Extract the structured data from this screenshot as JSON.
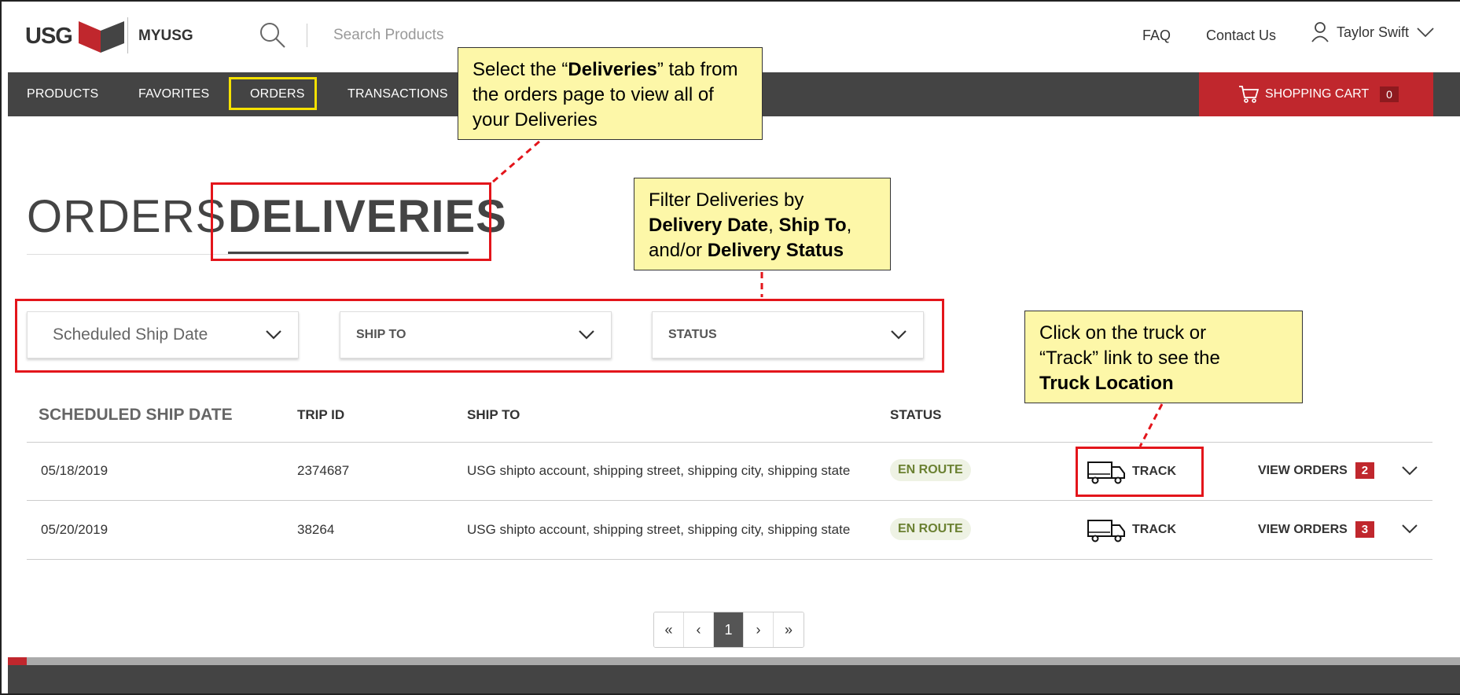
{
  "header": {
    "logo_text": "USG",
    "app_name": "MYUSG",
    "search_placeholder": "Search Products",
    "faq": "FAQ",
    "contact": "Contact Us",
    "user_name": "Taylor Swift"
  },
  "nav": {
    "items": [
      "PRODUCTS",
      "FAVORITES",
      "ORDERS",
      "TRANSACTIONS"
    ],
    "cart_label": "SHOPPING CART",
    "cart_count": "0"
  },
  "tabs": {
    "orders": "ORDERS",
    "deliveries": "DELIVERIES"
  },
  "filters": {
    "date": "Scheduled Ship Date",
    "ship_to": "SHIP TO",
    "status": "STATUS"
  },
  "table": {
    "headers": [
      "SCHEDULED SHIP DATE",
      "TRIP ID",
      "SHIP TO",
      "STATUS"
    ],
    "rows": [
      {
        "date": "05/18/2019",
        "trip_id": "2374687",
        "ship_to": "USG shipto account, shipping street, shipping city, shipping state",
        "status": "EN ROUTE",
        "track": "TRACK",
        "view_orders": "VIEW ORDERS",
        "order_count": "2"
      },
      {
        "date": "05/20/2019",
        "trip_id": "38264",
        "ship_to": "USG shipto account, shipping street, shipping city, shipping state",
        "status": "EN ROUTE",
        "track": "TRACK",
        "view_orders": "VIEW ORDERS",
        "order_count": "3"
      }
    ]
  },
  "pagination": {
    "first": "«",
    "prev": "‹",
    "current": "1",
    "next": "›",
    "last": "»"
  },
  "annotations": {
    "callout1": {
      "pre": "Select the “",
      "bold": "Deliveries",
      "post": "” tab from the orders page to view all of your Deliveries"
    },
    "callout2": {
      "line1": "Filter Deliveries by",
      "b1": "Delivery Date",
      "sep1": ", ",
      "b2": "Ship To",
      "sep2": ",",
      "line3_pre": "and/or ",
      "b3": "Delivery Status"
    },
    "callout3": {
      "line1": "Click on the truck or",
      "line2": "“Track” link to see the",
      "b1": "Truck Location"
    }
  },
  "colors": {
    "brand_red": "#c0272d",
    "nav_gray": "#444444",
    "status_green": "#6b8132",
    "annotation_red": "#e3151b",
    "annotation_yellow": "#fdf7a8"
  }
}
